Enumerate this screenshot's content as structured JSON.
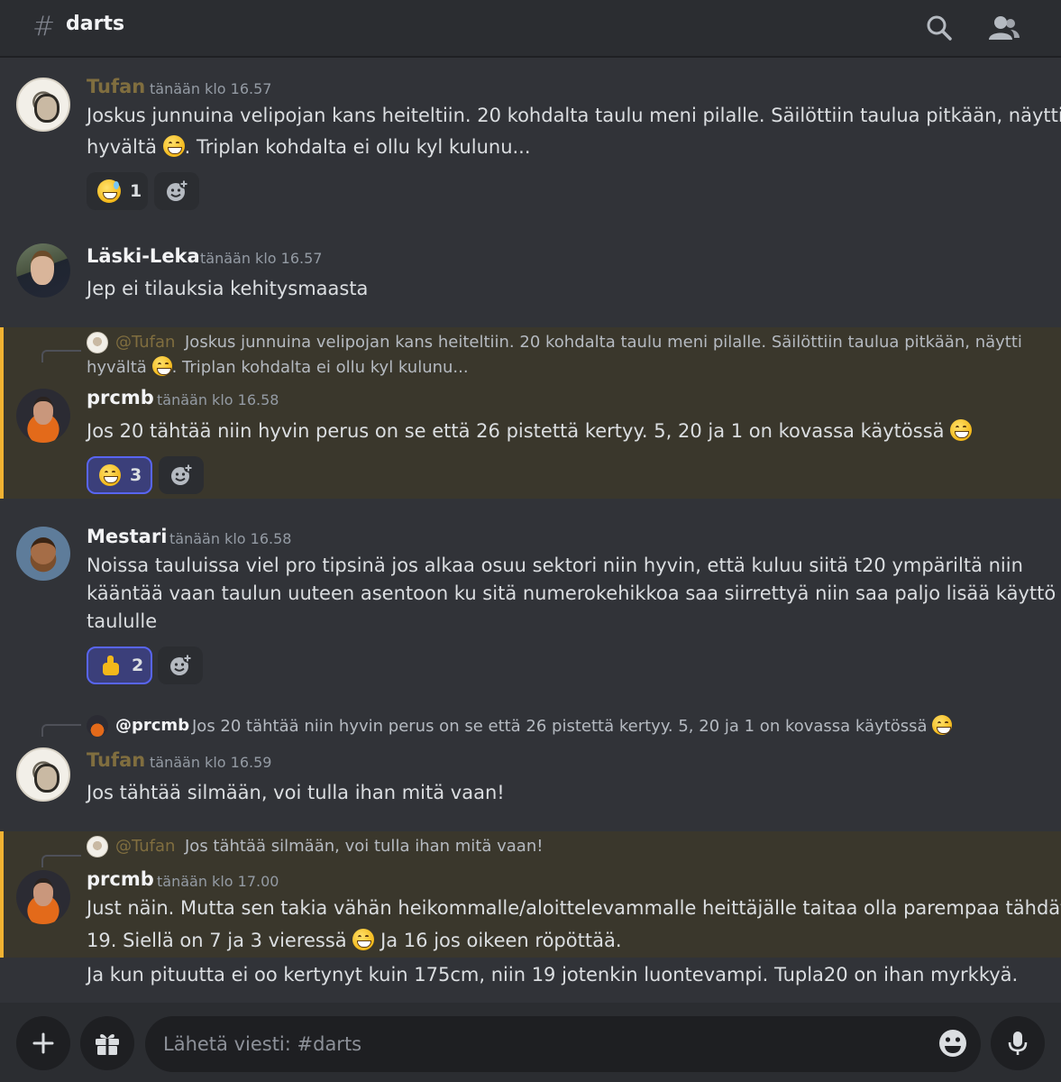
{
  "header": {
    "hash": "#",
    "channel": "darts"
  },
  "messages": [
    {
      "author": "Tufan",
      "time": "tänään klo 16.57",
      "line1": "Joskus junnuina velipojan kans heiteltiin. 20 kohdalta taulu meni pilalle. Säilöttiin taulua pitkään, näytti",
      "line2a": "hyvältä",
      "line2b": ". Triplan kohdalta ei ollu kyl kulunu...",
      "reactions": [
        {
          "emoji": "sweat-smile",
          "count": "1"
        }
      ]
    },
    {
      "author": "Läski-Leka",
      "time": "tänään klo 16.57",
      "text": "Jep ei tilauksia kehitysmaasta"
    },
    {
      "author": "prcmb",
      "time": "tänään klo 16.58",
      "reply": {
        "author": "@Tufan",
        "line1": "Joskus junnuina velipojan kans heiteltiin. 20 kohdalta taulu meni pilalle. Säilöttiin taulua pitkään, näytti",
        "line2a": "hyvältä",
        "line2b": ". Triplan kohdalta ei ollu kyl kulunu..."
      },
      "text": "Jos 20 tähtää niin hyvin perus on se että 26 pistettä kertyy. 5, 20 ja 1 on kovassa käytössä",
      "reactions": [
        {
          "emoji": "grin",
          "count": "3"
        }
      ]
    },
    {
      "author": "Mestari",
      "time": "tänään klo 16.58",
      "line1": "Noissa tauluissa viel pro tipsinä jos alkaa osuu sektori niin hyvin, että kuluu siitä t20 ympäriltä niin",
      "line2": "kääntää vaan taulun uuteen asentoon ku sitä numerokehikkoa saa siirrettyä niin saa paljo lisää käyttö ikää",
      "line3": "taululle",
      "reactions": [
        {
          "emoji": "thumbs-up",
          "count": "2"
        }
      ]
    },
    {
      "author": "Tufan",
      "time": "tänään klo 16.59",
      "reply": {
        "author": "@prcmb",
        "text": "Jos 20 tähtää niin hyvin perus on se että 26 pistettä kertyy. 5, 20 ja 1 on kovassa käytössä"
      },
      "text": "Jos tähtää silmään, voi tulla ihan mitä vaan!"
    },
    {
      "author": "prcmb",
      "time": "tänään klo 17.00",
      "reply": {
        "author": "@Tufan",
        "text": "Jos tähtää silmään, voi tulla ihan mitä vaan!"
      },
      "line1": "Just näin. Mutta sen takia vähän heikommalle/aloittelevammalle heittäjälle taitaa olla parempaa tähdätä",
      "line2a": "19. Siellä on 7 ja 3 vieressä",
      "line2b": "Ja 16 jos oikeen röpöttää.",
      "line3": "Ja kun pituutta ei oo kertynyt kuin 175cm, niin 19 jotenkin luontevampi. Tupla20 on ihan myrkkyä."
    }
  ],
  "composer": {
    "placeholder": "Lähetä viesti: #darts"
  },
  "colors": {
    "background": "#313338",
    "header": "#2b2d31",
    "highlight": "#3a372c",
    "highlight_border": "#f0b232",
    "tufan_name": "#806e3f",
    "reaction_active": "#5865f2"
  },
  "icons": [
    "search-icon",
    "members-icon",
    "plus-icon",
    "gift-icon",
    "emoji-icon",
    "mic-icon",
    "add-reaction-icon"
  ]
}
